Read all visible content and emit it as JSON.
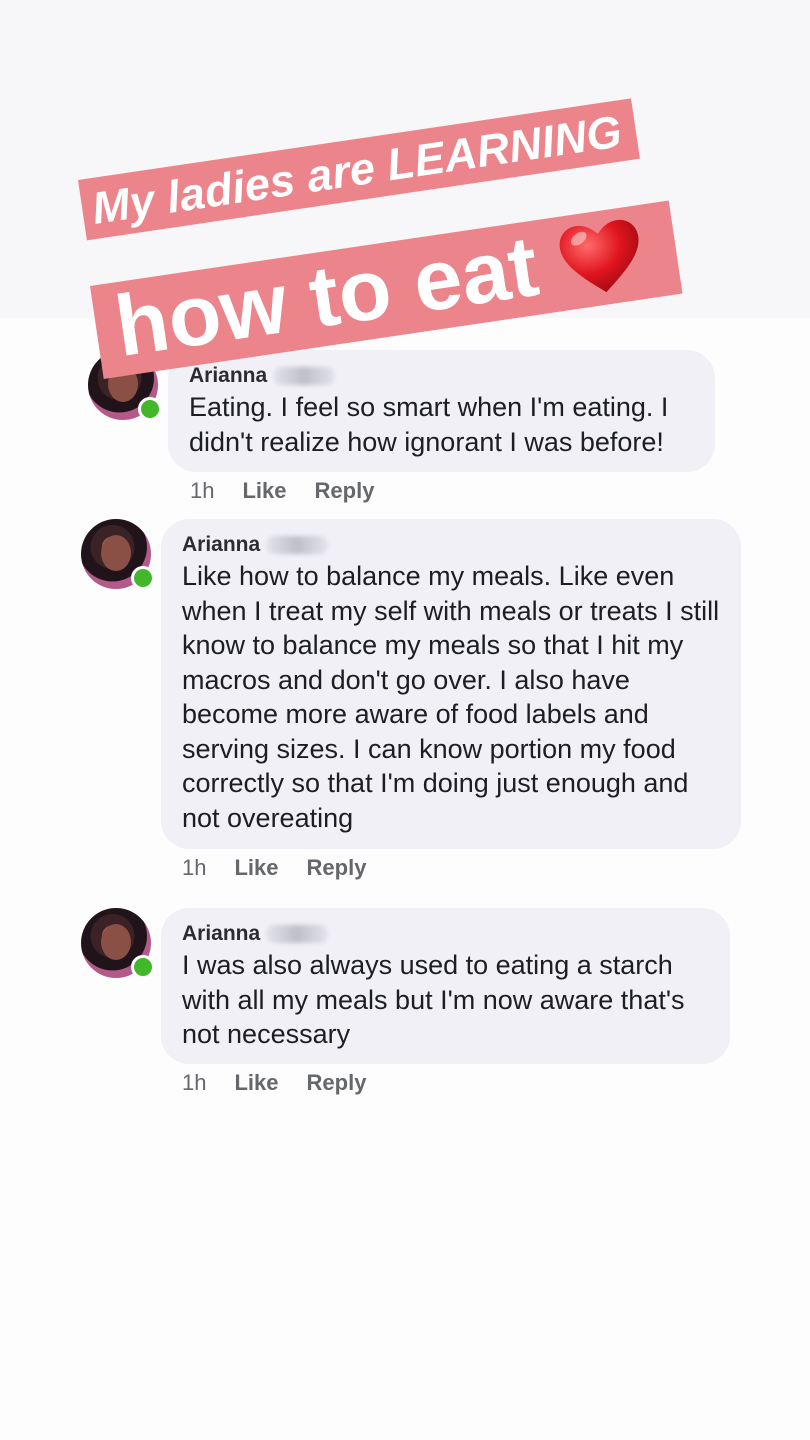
{
  "banner": {
    "line1": "My ladies are LEARNING",
    "line2": "how to eat",
    "heart_icon": "red-heart-emoji",
    "background_color": "#ec848b"
  },
  "comments": [
    {
      "author": "Arianna",
      "text": "Eating. I feel so smart when I'm eating. I didn't realize how ignorant I was before!",
      "time": "1h",
      "like_label": "Like",
      "reply_label": "Reply",
      "online": true
    },
    {
      "author": "Arianna",
      "text": "Like how to balance my meals. Like even when I treat my self with meals or treats I still know to balance my meals so that I hit my macros and don't go over. I also have become more aware of food labels and serving sizes. I can know portion my food correctly so that I'm doing just enough and not overeating",
      "time": "1h",
      "like_label": "Like",
      "reply_label": "Reply",
      "online": true
    },
    {
      "author": "Arianna",
      "text": "I was also always used to eating a starch with all my meals but I'm now aware that's not necessary",
      "time": "1h",
      "like_label": "Like",
      "reply_label": "Reply",
      "online": true
    }
  ],
  "colors": {
    "bubble": "#f0f0f6",
    "online": "#42b72a",
    "meta_text": "#65676b"
  }
}
